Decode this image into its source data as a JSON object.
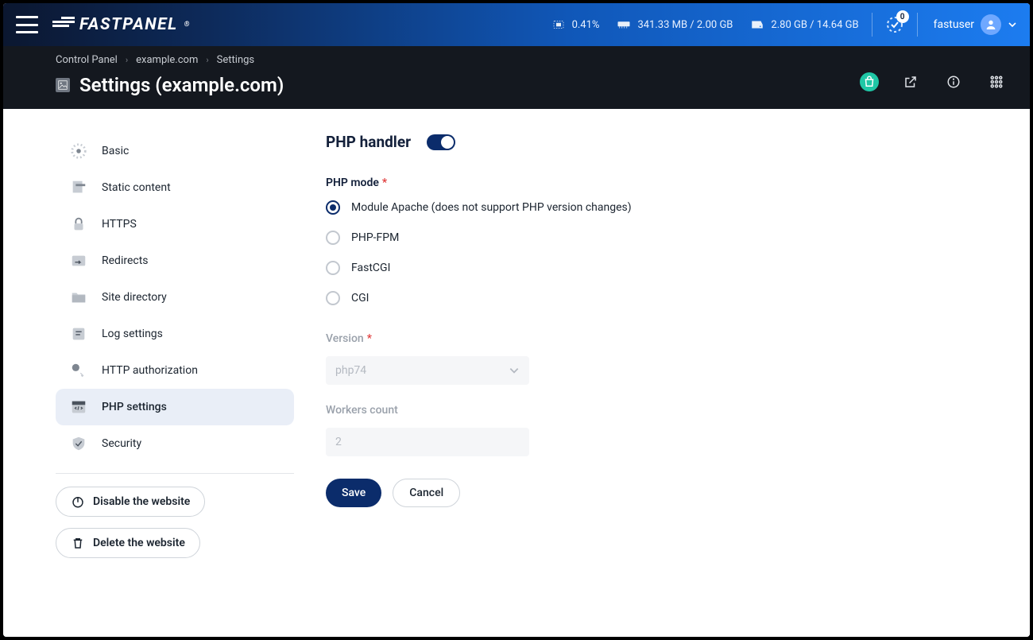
{
  "brand": "FASTPANEL",
  "topstats": {
    "cpu": "0.41%",
    "ram": "341.33 MB / 2.00 GB",
    "disk": "2.80 GB / 14.64 GB"
  },
  "tasks_badge": "0",
  "user": {
    "name": "fastuser"
  },
  "breadcrumb": [
    "Control Panel",
    "example.com",
    "Settings"
  ],
  "page_title": "Settings (example.com)",
  "sidenav": {
    "items": [
      {
        "label": "Basic"
      },
      {
        "label": "Static content"
      },
      {
        "label": "HTTPS"
      },
      {
        "label": "Redirects"
      },
      {
        "label": "Site directory"
      },
      {
        "label": "Log settings"
      },
      {
        "label": "HTTP authorization"
      },
      {
        "label": "PHP settings"
      },
      {
        "label": "Security"
      }
    ],
    "disable_btn": "Disable the website",
    "delete_btn": "Delete the website"
  },
  "main": {
    "section_title": "PHP handler",
    "php_mode_label": "PHP mode",
    "radios": [
      "Module Apache (does not support PHP version changes)",
      "PHP-FPM",
      "FastCGI",
      "CGI"
    ],
    "version_label": "Version",
    "version_value": "php74",
    "workers_label": "Workers count",
    "workers_value": "2",
    "save": "Save",
    "cancel": "Cancel"
  }
}
